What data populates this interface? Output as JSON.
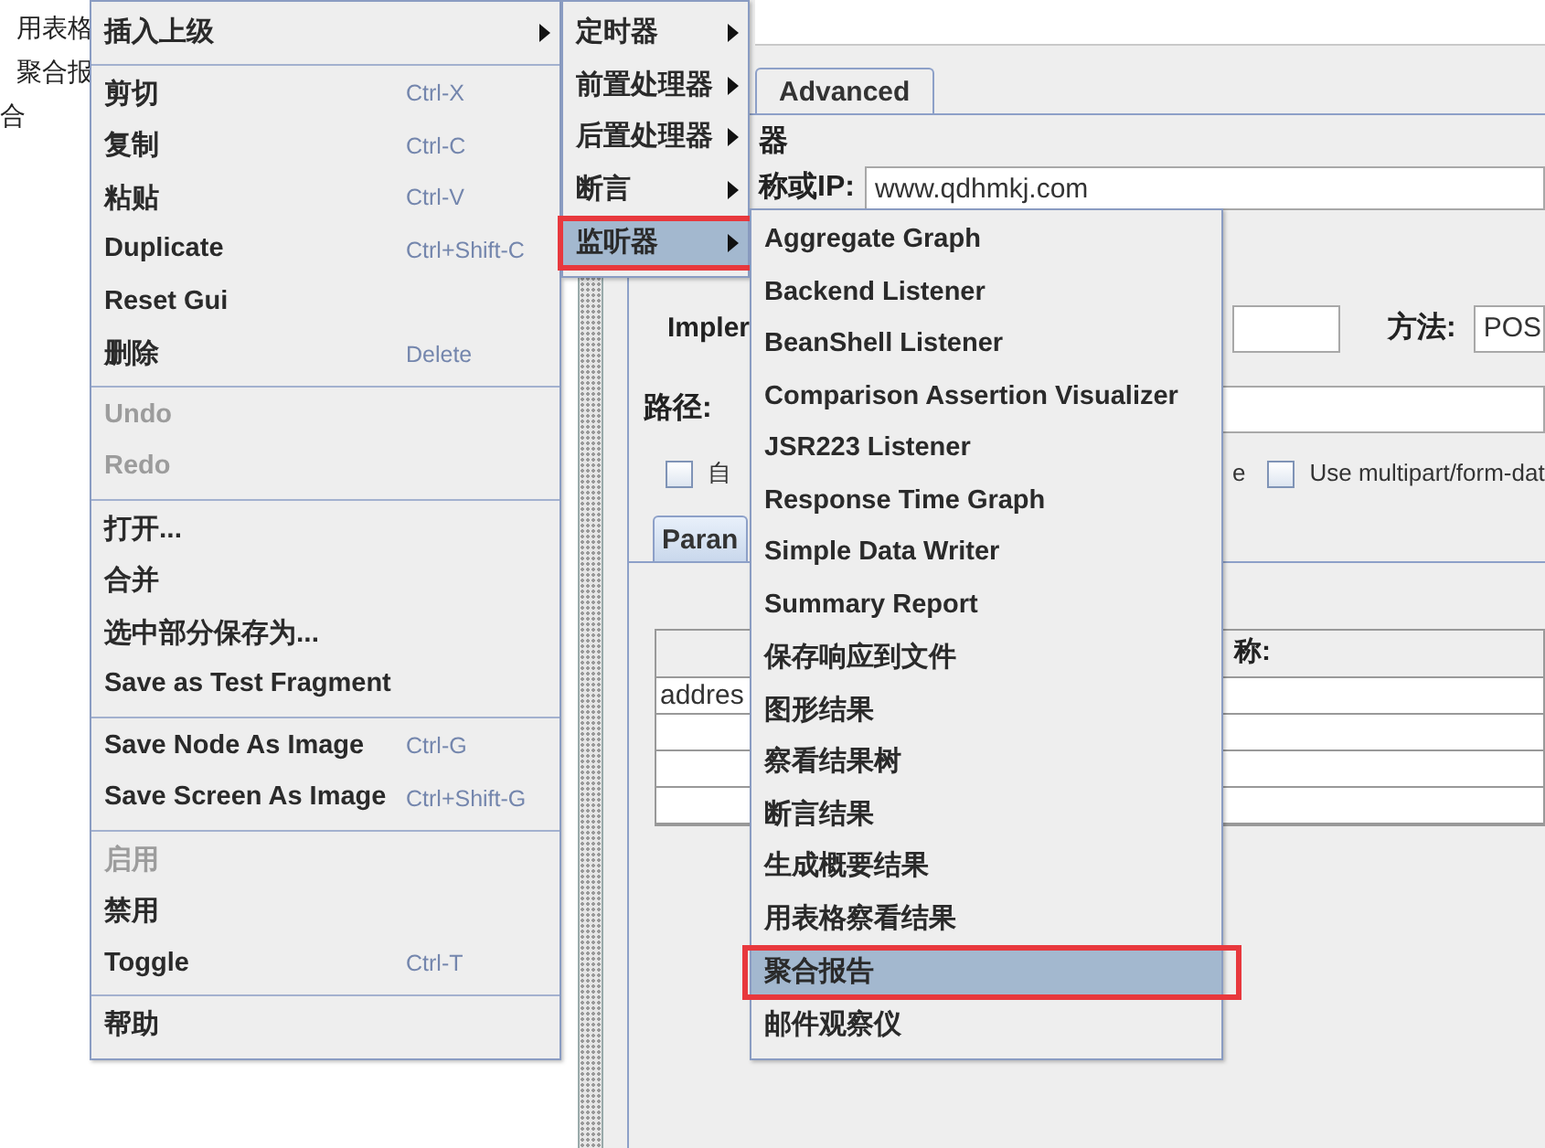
{
  "tree": {
    "items": [
      {
        "label": "用表格"
      },
      {
        "label": "聚合报"
      },
      {
        "label": "合"
      }
    ]
  },
  "editor": {
    "tabs": [
      {
        "label": "Advanced",
        "selected": false
      }
    ],
    "section_title": "器",
    "server_label": "称或IP:",
    "server_value": "www.qdhmkj.com",
    "impl_label": "Impler",
    "method_label": "方法:",
    "method_value": "POS",
    "path_label": "路径:",
    "checkboxes": [
      {
        "label": "自",
        "checked": false
      },
      {
        "label": "Use multipart/form-dat",
        "checked": false,
        "prefix": "e"
      }
    ],
    "param_tabs": [
      {
        "label": "Paran",
        "selected": true
      }
    ],
    "table": {
      "header": "称:",
      "rows": [
        {
          "cells": [
            "addres"
          ]
        }
      ]
    }
  },
  "context_menu": {
    "items": [
      {
        "kind": "item",
        "label": "插入上级",
        "submenu": true,
        "disabled": false
      },
      {
        "kind": "separator"
      },
      {
        "kind": "item",
        "label": "剪切",
        "shortcut": "Ctrl-X",
        "disabled": false
      },
      {
        "kind": "item",
        "label": "复制",
        "shortcut": "Ctrl-C",
        "disabled": false
      },
      {
        "kind": "item",
        "label": "粘贴",
        "shortcut": "Ctrl-V",
        "disabled": false
      },
      {
        "kind": "item",
        "label": "Duplicate",
        "shortcut": "Ctrl+Shift-C",
        "disabled": false
      },
      {
        "kind": "item",
        "label": "Reset Gui",
        "disabled": false
      },
      {
        "kind": "item",
        "label": "删除",
        "shortcut": "Delete",
        "disabled": false
      },
      {
        "kind": "separator"
      },
      {
        "kind": "item",
        "label": "Undo",
        "disabled": true
      },
      {
        "kind": "item",
        "label": "Redo",
        "disabled": true
      },
      {
        "kind": "separator"
      },
      {
        "kind": "item",
        "label": "打开...",
        "disabled": false
      },
      {
        "kind": "item",
        "label": "合并",
        "disabled": false
      },
      {
        "kind": "item",
        "label": "选中部分保存为...",
        "disabled": false
      },
      {
        "kind": "item",
        "label": "Save as Test Fragment",
        "disabled": false
      },
      {
        "kind": "separator"
      },
      {
        "kind": "item",
        "label": "Save Node As Image",
        "shortcut": "Ctrl-G",
        "disabled": false
      },
      {
        "kind": "item",
        "label": "Save Screen As Image",
        "shortcut": "Ctrl+Shift-G",
        "disabled": false
      },
      {
        "kind": "separator"
      },
      {
        "kind": "item",
        "label": "启用",
        "disabled": true
      },
      {
        "kind": "item",
        "label": "禁用",
        "disabled": false
      },
      {
        "kind": "item",
        "label": "Toggle",
        "shortcut": "Ctrl-T",
        "disabled": false
      },
      {
        "kind": "separator"
      },
      {
        "kind": "item",
        "label": "帮助",
        "disabled": false
      }
    ]
  },
  "insert_menu": {
    "items": [
      {
        "label": "定时器",
        "submenu": true,
        "selected": false
      },
      {
        "label": "前置处理器",
        "submenu": true,
        "selected": false
      },
      {
        "label": "后置处理器",
        "submenu": true,
        "selected": false
      },
      {
        "label": "断言",
        "submenu": true,
        "selected": false
      },
      {
        "label": "监听器",
        "submenu": true,
        "selected": true
      }
    ]
  },
  "listener_menu": {
    "items": [
      {
        "label": "Aggregate Graph",
        "selected": false
      },
      {
        "label": "Backend Listener",
        "selected": false
      },
      {
        "label": "BeanShell Listener",
        "selected": false
      },
      {
        "label": "Comparison Assertion Visualizer",
        "selected": false
      },
      {
        "label": "JSR223 Listener",
        "selected": false
      },
      {
        "label": "Response Time Graph",
        "selected": false
      },
      {
        "label": "Simple Data Writer",
        "selected": false
      },
      {
        "label": "Summary Report",
        "selected": false
      },
      {
        "label": "保存响应到文件",
        "selected": false
      },
      {
        "label": "图形结果",
        "selected": false
      },
      {
        "label": "察看结果树",
        "selected": false
      },
      {
        "label": "断言结果",
        "selected": false
      },
      {
        "label": "生成概要结果",
        "selected": false
      },
      {
        "label": "用表格察看结果",
        "selected": false
      },
      {
        "label": "聚合报告",
        "selected": true
      },
      {
        "label": "邮件观察仪",
        "selected": false
      }
    ]
  }
}
